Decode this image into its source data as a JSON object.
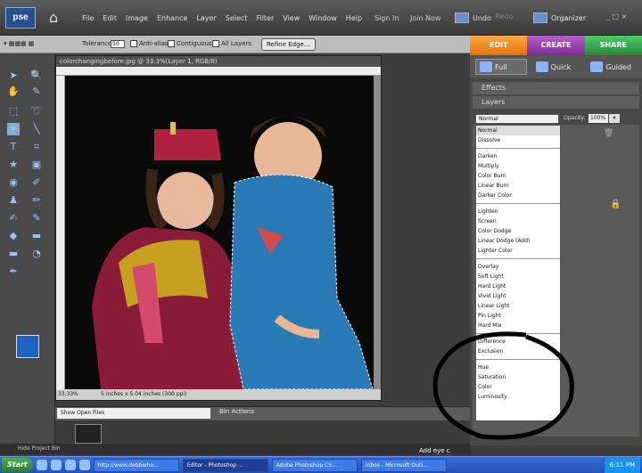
{
  "app": {
    "logo_text": "pse",
    "home_icon": "home-icon"
  },
  "menu": {
    "items": [
      "File",
      "Edit",
      "Image",
      "Enhance",
      "Layer",
      "Select",
      "Filter",
      "View",
      "Window",
      "Help"
    ],
    "sign_in": "Sign In",
    "join_now": "Join Now",
    "undo": "Undo",
    "redo": "Redo",
    "organizer": "Organizer",
    "window_controls": "_ □ ×"
  },
  "options": {
    "tolerance_label": "Tolerance:",
    "tolerance_value": "50",
    "anti_alias": "Anti-alias",
    "contiguous": "Contiguous",
    "all_layers": "All Layers",
    "refine_edge": "Refine Edge..."
  },
  "tabs": {
    "edit": "EDIT",
    "create": "CREATE",
    "share": "SHARE"
  },
  "modes": {
    "full": "Full",
    "quick": "Quick",
    "guided": "Guided"
  },
  "panels": {
    "effects": "Effects",
    "layers": "Layers"
  },
  "document": {
    "title": "colorchangingbefore.jpg @ 33.3%(Layer 1, RGB/8)",
    "zoom": "33.33%",
    "dimensions": "5 inches x 5.04 inches (300 ppi)"
  },
  "layers": {
    "blend_mode": "Normal",
    "opacity_label": "Opacity:",
    "opacity_value": "100%"
  },
  "blend_modes": [
    [
      "Normal",
      "Dissolve"
    ],
    [
      "Darken",
      "Multiply",
      "Color Burn",
      "Linear Burn",
      "Darker Color"
    ],
    [
      "Lighten",
      "Screen",
      "Color Dodge",
      "Linear Dodge (Add)",
      "Lighter Color"
    ],
    [
      "Overlay",
      "Soft Light",
      "Hard Light",
      "Vivid Light",
      "Linear Light",
      "Pin Light",
      "Hard Mix"
    ],
    [
      "Difference",
      "Exclusion"
    ],
    [
      "Hue",
      "Saturation",
      "Color",
      "Luminosity"
    ]
  ],
  "bin": {
    "show_files": "Show Open Files",
    "bin_actions": "Bin Actions",
    "hide_bin": "Hide Project Bin",
    "add_eye": "Add eye c"
  },
  "taskbar": {
    "start": "Start",
    "items": [
      "http://www.debbieho...",
      "Editor - Photoshop ...",
      "Adobe Photoshop CS...",
      "Inbox - Microsoft Outl..."
    ],
    "clock": "6:11 PM"
  },
  "colors": {
    "foreground": "#1d63c4",
    "background": "#111111",
    "edit_tab": "#f08a1e",
    "create_tab": "#9a45b0",
    "share_tab": "#35a64f"
  }
}
